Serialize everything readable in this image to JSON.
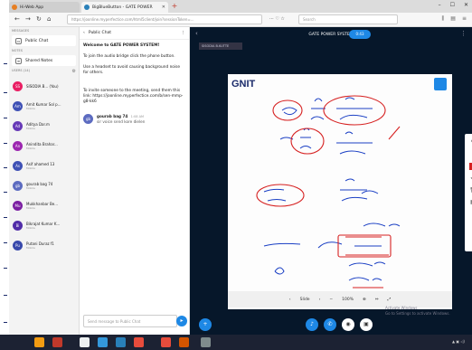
{
  "browser": {
    "tabs": [
      {
        "label": "Hi-Web App",
        "color": "#e67e22"
      },
      {
        "label": "BigBlueButton - GATE POWER",
        "color": "#2980b9"
      }
    ],
    "url": "https://joonline.myperfectice.com/html5client/join?sessionToken=...",
    "search_placeholder": "Search"
  },
  "sidebar": {
    "messages_heading": "MESSAGES",
    "public_chat": "Public Chat",
    "notes_heading": "NOTES",
    "shared_notes": "Shared Notes",
    "users_heading": "USERS (14)",
    "users": [
      {
        "initials": "SS",
        "name": "SISODIA B... (You)",
        "sub": "",
        "color": "#e91e63"
      },
      {
        "initials": "Am",
        "name": "Amit Kumar Sol p...",
        "sub": "Mobile",
        "color": "#3f51b5"
      },
      {
        "initials": "Ad",
        "name": "Aditya Dar.m",
        "sub": "Mobile",
        "color": "#673ab7"
      },
      {
        "initials": "An",
        "name": "Anindita Brahar...",
        "sub": "Mobile",
        "color": "#9c27b0"
      },
      {
        "initials": "As",
        "name": "Asif ahamed 13",
        "sub": "Mobile",
        "color": "#3f51b5"
      },
      {
        "initials": "gb",
        "name": "gourab bag 74",
        "sub": "Mobile",
        "color": "#5c6bc0"
      },
      {
        "initials": "Mu",
        "name": "Mukkhanbar Be...",
        "sub": "Mobile",
        "color": "#7b1fa2"
      },
      {
        "initials": "Bi",
        "name": "Bikrajat Kumar K...",
        "sub": "Mobile",
        "color": "#512da8"
      },
      {
        "initials": "Pu",
        "name": "Putani Duraz f1",
        "sub": "Mobile",
        "color": "#3949ab"
      }
    ]
  },
  "chat": {
    "title": "Public Chat",
    "welcome_title": "Welcome to GATE POWER SYSTEM!",
    "welcome_line1": "To join the audio bridge click the phone button.",
    "welcome_line2": "Use a headset to avoid causing background noise for others.",
    "invite_line": "To invite someone to the meeting, send them this link: https://joonline.myperfectice.com/b/sen-mmp-g8-kk6",
    "message_author": "gourab bag 74",
    "message_time": "1:08 AM",
    "message_text": "sir voice send kore dielen",
    "input_placeholder": "Send message to Public Chat"
  },
  "presentation": {
    "title": "GATE POWER SYSTEM",
    "record_label": "0:43",
    "presenter_label": "SISODIA B.KUTTE",
    "slide_logo": "GNIT",
    "slide_control": "Slide",
    "zoom": "100%",
    "watermark_line1": "Activate Windows",
    "watermark_line2": "Go to Settings to activate Windows."
  },
  "colors": {
    "accent": "#1e88e5",
    "presentation_bg": "#06172a",
    "ink_blue": "#1a3fc4",
    "ink_red": "#d62020"
  }
}
